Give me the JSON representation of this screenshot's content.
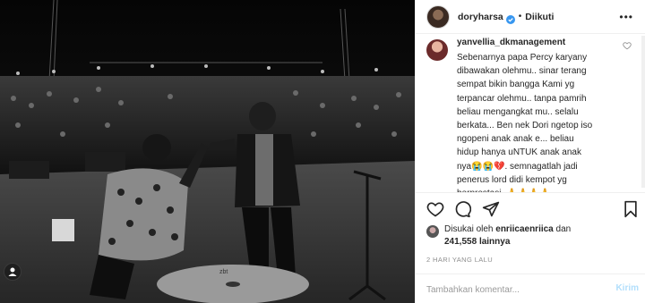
{
  "post": {
    "username": "doryharsa",
    "follow_status": "Diikuti",
    "separator": "•",
    "more": "•••",
    "verified": true
  },
  "comment": {
    "username": "yanvellia_dkmanagement",
    "text": "Sebenarnya papa Percy karyany\ndibawakan olehmu.. sinar terang\nsempat bikin bangga Kami yg\nterpancar olehmu.. tanpa pamrih\nbeliau mengangkat mu.. selalu\nberkata... Ben nek Dori ngetop iso\nngopeni anak anak e... beliau\nhidup hanya uNTUK anak anak\nnya😭😭💔. semnagatlah jadi\npenerus lord didi kempot yg\nberprestasi..🙏🙏🙏🙏"
  },
  "icons": {
    "like": "heart-icon",
    "comment": "comment-icon",
    "share": "share-icon",
    "save": "bookmark-icon",
    "tag": "user-tag-icon",
    "verified": "verified-badge-icon"
  },
  "likes": {
    "prefix": "Disukai oleh",
    "liked_by": "enriicaenriica",
    "conjunction": "dan",
    "count": "241,558",
    "suffix": "lainnya"
  },
  "timestamp": "2 HARI YANG LALU",
  "add_comment": {
    "placeholder": "Tambahkan komentar...",
    "post_label": "Kirim"
  },
  "colors": {
    "verified": "#3897f0",
    "post_disabled": "#b2dffc",
    "muted": "#8e8e8e",
    "border": "#efefef"
  }
}
